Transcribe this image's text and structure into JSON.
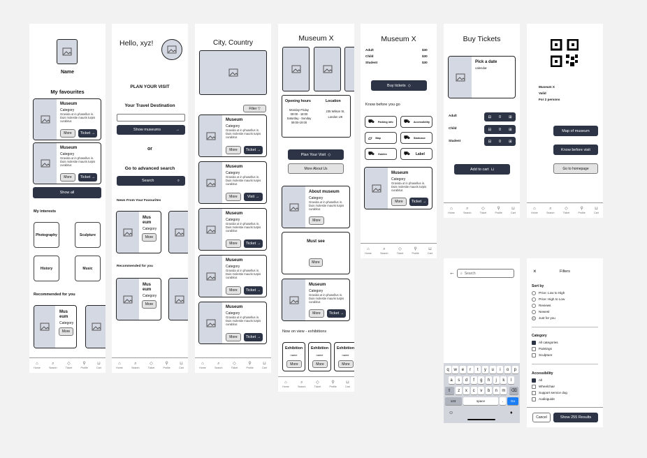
{
  "colors": {
    "dark": "#2c3446",
    "placeholder": "#d3d8e3",
    "bg": "#f2f2f2",
    "blue": "#1c7ef5"
  },
  "nav": [
    "Home",
    "Search",
    "Ticket",
    "Profile",
    "Cart"
  ],
  "common": {
    "more": "More",
    "ticket": "Ticket →",
    "visit": "Visit →",
    "museum": "Museum",
    "category": "Category",
    "desc": "Gravida ut in phasellus in. Duis molestie mauris turpis curabitur."
  },
  "profile": {
    "name": "Name",
    "favourites_title": "My favourites",
    "show_all": "Show all",
    "interests_title": "My interests",
    "interests": [
      "Photography",
      "Sculpture",
      "History",
      "Music"
    ],
    "recommended_title": "Recommended for you",
    "mus": "Mus",
    "eum": "eum"
  },
  "home": {
    "greeting": "Hello, xyz!",
    "plan": "PLAN YOUR VISIT",
    "destination": "Your Travel Destination",
    "show_museums": "Show museums",
    "or": "or",
    "advanced": "Go to advanced search",
    "search": "Search",
    "news": "News From Your Favourites",
    "recommended": "Recommended for you",
    "mus": "Mus",
    "eum": "eum"
  },
  "city": {
    "title": "City, Country",
    "filter": "Filter"
  },
  "museumx": {
    "title": "Museum X",
    "opening": "Opening hours",
    "location": "Location",
    "hours": [
      "Monday-Friday",
      "09:00 - 18:00",
      "Saturday - Sunday",
      "09:00-19:00"
    ],
    "address": [
      "235 Wilson St,",
      "London UK"
    ],
    "plan_visit": "Plan Your Visit",
    "about_more": "More About Us",
    "about_title": "About museum",
    "must_see": "Must see",
    "on_view": "Now on view - exhibitions",
    "exhibition": "Exhibition",
    "ex_name": "name"
  },
  "museumx2": {
    "title": "Museum X",
    "prices": [
      {
        "label": "Adult",
        "price": "$30"
      },
      {
        "label": "Child",
        "price": "$30"
      },
      {
        "label": "Student",
        "price": "$30"
      }
    ],
    "buy": "Buy tickets",
    "know": "Know before you go",
    "infos": [
      "Parking info",
      "Accessibility",
      "Map",
      "Staircase",
      "Guides",
      "Label"
    ]
  },
  "buy": {
    "title": "Buy Tickets",
    "pick": "Pick a date",
    "calendar": "calendar",
    "rows": [
      {
        "label": "Adult",
        "qty": "0"
      },
      {
        "label": "Child",
        "qty": "0"
      },
      {
        "label": "Student",
        "qty": "0"
      }
    ],
    "add": "Add to cart"
  },
  "ticket": {
    "lines": [
      "Museum X",
      "Valid",
      "For 2 persons"
    ],
    "map": "Map of museum",
    "know": "Know before visit",
    "home": "Go to homepage"
  },
  "search": {
    "placeholder": "Search",
    "row1": [
      "q",
      "w",
      "e",
      "r",
      "t",
      "y",
      "u",
      "i",
      "o",
      "p"
    ],
    "row2": [
      "a",
      "s",
      "d",
      "f",
      "g",
      "h",
      "j",
      "k",
      "l"
    ],
    "row3": [
      "z",
      "x",
      "c",
      "v",
      "b",
      "n",
      "m"
    ],
    "num": "123",
    "space": "space",
    "dot": ".",
    "go": "Go"
  },
  "filters": {
    "title": "Filters",
    "close": "×",
    "sort_title": "Sort by",
    "sort": [
      "Price: Low to High",
      "Price: High to Low",
      "Reviews",
      "Newest",
      "Just for you"
    ],
    "cat_title": "Category",
    "cats": [
      "All categories",
      "Paintings",
      "Sculpture"
    ],
    "acc_title": "Accessibility",
    "acc": [
      "All",
      "Wheelchair",
      "Support service dog",
      "Audioguide"
    ],
    "cancel": "Cancel",
    "show": "Show 255 Results"
  }
}
